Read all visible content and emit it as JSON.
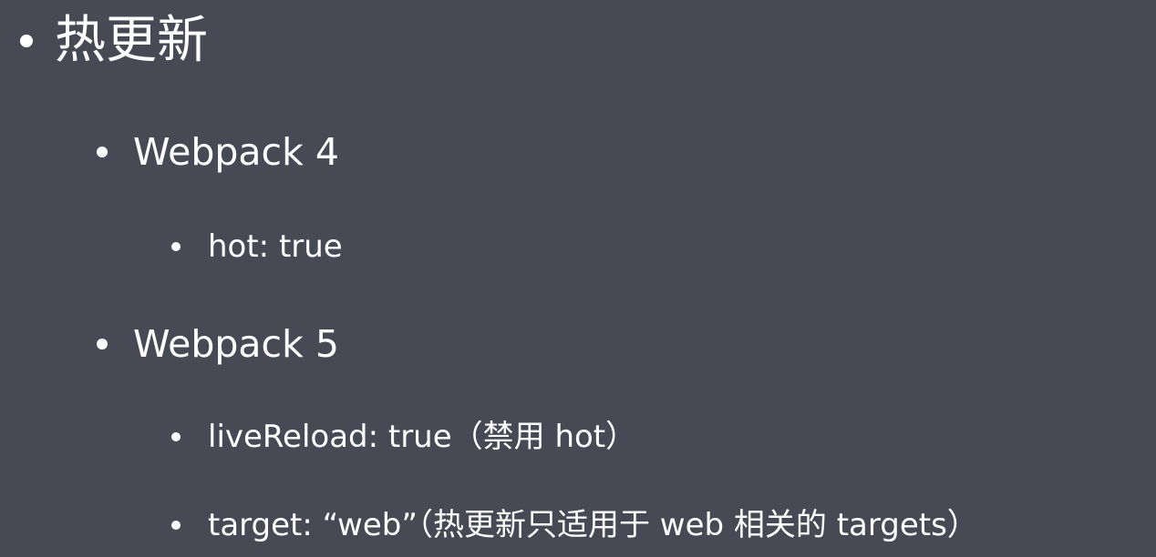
{
  "slide": {
    "heading": "热更新",
    "items": [
      {
        "level": 1,
        "text": "Webpack 4"
      },
      {
        "level": 2,
        "text": "hot: true"
      },
      {
        "level": 1,
        "text": "Webpack 5"
      },
      {
        "level": 2,
        "text": "liveReload: true（禁用 hot）"
      },
      {
        "level": 2,
        "text": "target: “web”（热更新只适用于 web 相关的 targets）"
      }
    ]
  },
  "colors": {
    "background": "#474a55",
    "text": "#ffffff"
  }
}
